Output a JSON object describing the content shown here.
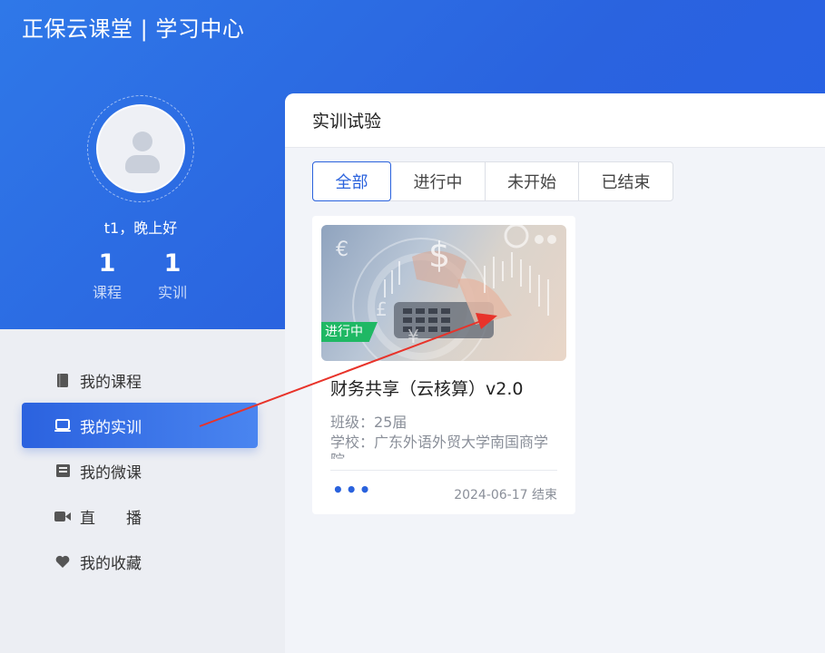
{
  "app": {
    "title": "正保云课堂 | 学习中心"
  },
  "profile": {
    "greeting": "t1，晚上好",
    "stats": [
      {
        "value": "1",
        "label": "课程"
      },
      {
        "value": "1",
        "label": "实训"
      }
    ]
  },
  "sidebar": {
    "items": [
      {
        "label": "我的课程",
        "icon": "book-icon"
      },
      {
        "label": "我的实训",
        "icon": "laptop-icon",
        "active": true
      },
      {
        "label": "我的微课",
        "icon": "inbox-icon"
      },
      {
        "label": "直　　播",
        "icon": "video-camera-icon"
      },
      {
        "label": "我的收藏",
        "icon": "heart-icon"
      }
    ]
  },
  "main": {
    "title": "实训试验",
    "tabs": [
      "全部",
      "进行中",
      "未开始",
      "已结束"
    ],
    "cards": [
      {
        "status": "进行中",
        "title": "财务共享（云核算）v2.0",
        "class_line": "班级：25届",
        "school_line": "学校：广东外语外贸大学南国商学院",
        "more": "•••",
        "date": "2024-06-17 结束"
      }
    ]
  },
  "colors": {
    "accent": "#2a62dd",
    "status_green": "#1fb864",
    "annotation_red": "#e8332a"
  }
}
